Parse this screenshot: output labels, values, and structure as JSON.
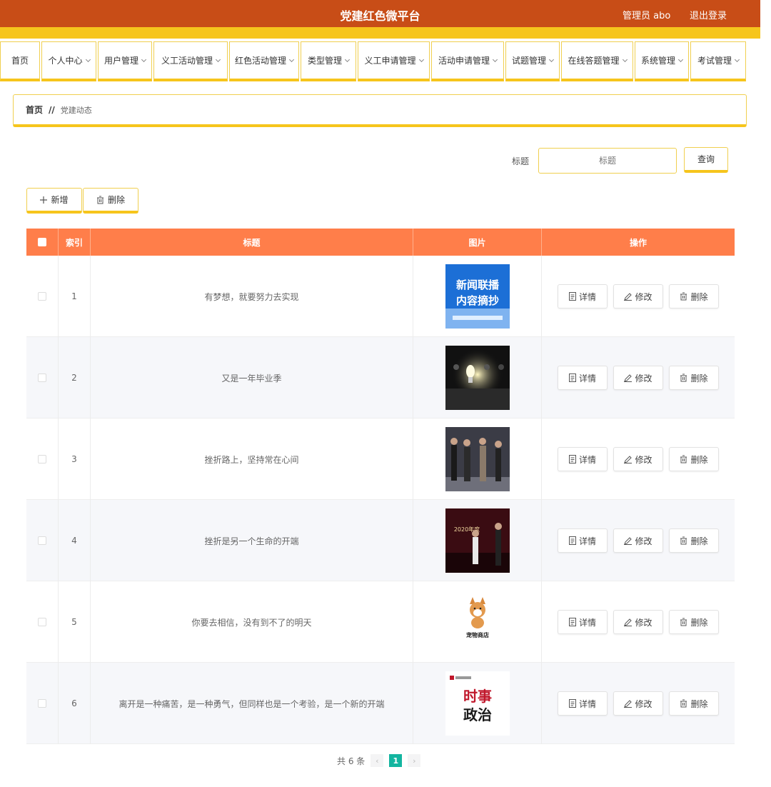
{
  "header": {
    "title": "党建红色微平台",
    "admin": "管理员 abo",
    "logout": "退出登录"
  },
  "nav": {
    "items": [
      {
        "label": "首页",
        "dropdown": false
      },
      {
        "label": "个人中心",
        "dropdown": true
      },
      {
        "label": "用户管理",
        "dropdown": true
      },
      {
        "label": "义工活动管理",
        "dropdown": true
      },
      {
        "label": "红色活动管理",
        "dropdown": true
      },
      {
        "label": "类型管理",
        "dropdown": true
      },
      {
        "label": "义工申请管理",
        "dropdown": true
      },
      {
        "label": "活动申请管理",
        "dropdown": true
      },
      {
        "label": "试题管理",
        "dropdown": true
      },
      {
        "label": "在线答题管理",
        "dropdown": true
      },
      {
        "label": "系统管理",
        "dropdown": true
      },
      {
        "label": "考试管理",
        "dropdown": true
      }
    ]
  },
  "breadcrumb": {
    "home": "首页",
    "separator": "//",
    "current": "党建动态"
  },
  "search": {
    "label": "标题",
    "placeholder": "标题",
    "button": "查询"
  },
  "actions": {
    "add": "新增",
    "delete": "删除"
  },
  "table": {
    "columns": [
      "索引",
      "标题",
      "图片",
      "操作"
    ],
    "rows": [
      {
        "index": "1",
        "title": "有梦想，就要努力去实现"
      },
      {
        "index": "2",
        "title": "又是一年毕业季"
      },
      {
        "index": "3",
        "title": "挫折路上，坚持常在心间"
      },
      {
        "index": "4",
        "title": "挫折是另一个生命的开端"
      },
      {
        "index": "5",
        "title": "你要去相信，没有到不了的明天"
      },
      {
        "index": "6",
        "title": "离开是一种痛苦，是一种勇气，但同样也是一个考验，是一个新的开端"
      }
    ],
    "row_actions": {
      "detail": "详情",
      "edit": "修改",
      "delete": "删除"
    },
    "image_texts": {
      "img1_line1": "新闻联播",
      "img1_line2": "内容摘抄",
      "img4_text": "2020年度",
      "img5_text": "宠物商店",
      "img6_line1": "时事",
      "img6_line2": "政治"
    }
  },
  "pagination": {
    "total": "共 6 条",
    "current_page": "1",
    "prev": "‹",
    "next": "›"
  },
  "colors": {
    "header": "#c84d17",
    "accent": "#f6c51c",
    "table_header": "#ff7e4a",
    "pager_active": "#13b5a0"
  }
}
